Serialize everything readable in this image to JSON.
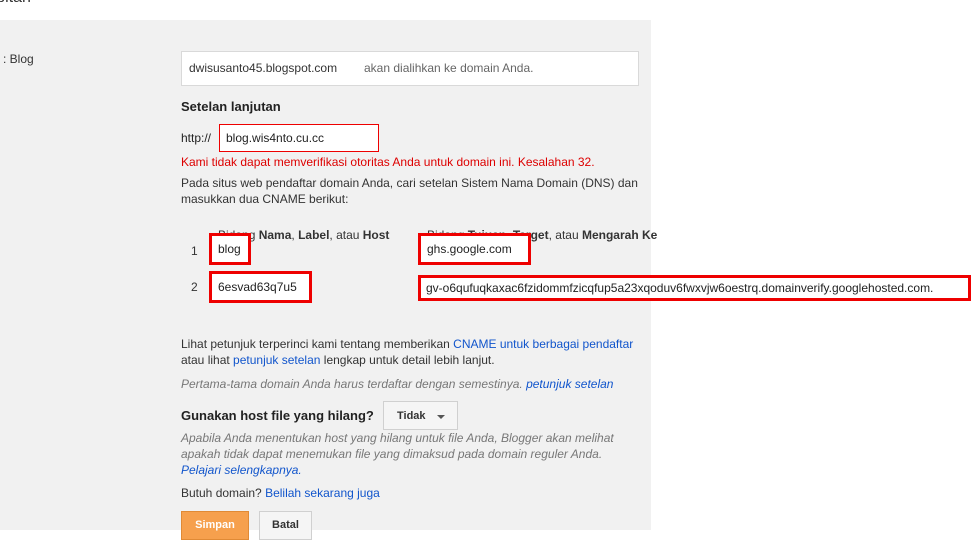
{
  "section_title": "erbitan",
  "left_label": ": Blog",
  "blog_address": {
    "value": "dwisusanto45.blogspot.com",
    "hint": "akan dialihkan ke domain Anda."
  },
  "advanced": {
    "title": "Setelan lanjutan",
    "http_label": "http://",
    "domain_value": "blog.wis4nto.cu.cc",
    "error": "Kami tidak dapat memverifikasi otoritas Anda untuk domain ini. Kesalahan 32.",
    "description": "Pada situs web pendaftar domain Anda, cari setelan Sistem Nama Domain (DNS) dan masukkan dua CNAME berikut:"
  },
  "cname_table": {
    "header_name": {
      "prefix": "Bidang ",
      "b1": "Nama",
      "sep1": ", ",
      "b2": "Label",
      "sep2": ", atau ",
      "b3": "Host"
    },
    "header_target": {
      "prefix": "Bidang ",
      "b1": "Tujuan",
      "sep1": ", ",
      "b2": "Target",
      "sep2": ", atau ",
      "b3": "Mengarah Ke"
    },
    "rows": [
      {
        "num": "1",
        "name": "blog",
        "target": "ghs.google.com"
      },
      {
        "num": "2",
        "name": "6esvad63q7u5",
        "target": "gv-o6qufuqkaxac6fzidommfzicqfup5a23xqoduv6fwxvjw6oestrq.domainverify.googlehosted.com."
      }
    ]
  },
  "info": {
    "text1": "Lihat petunjuk terperinci kami tentang memberikan ",
    "link1": "CNAME untuk berbagai pendaftar",
    "text2": " atau lihat ",
    "link2": "petunjuk setelan",
    "text3": " lengkap untuk detail lebih lanjut."
  },
  "note": {
    "text": "Pertama-tama domain Anda harus terdaftar dengan semestinya. ",
    "link": "petunjuk setelan"
  },
  "missing_files": {
    "label": "Gunakan host file yang hilang?",
    "selected": "Tidak",
    "help": "Apabila Anda menentukan host yang hilang untuk file Anda, Blogger akan melihat apakah tidak dapat menemukan file yang dimaksud pada domain reguler Anda. ",
    "help_link": "Pelajari selengkapnya."
  },
  "need_domain": {
    "text": "Butuh domain? ",
    "link": "Belilah sekarang juga"
  },
  "buttons": {
    "save": "Simpan",
    "cancel": "Batal"
  },
  "colors": {
    "error": "#dd0000",
    "link": "#1155cc",
    "save_button": "#f6a04d",
    "highlight_box": "#ee0000"
  }
}
